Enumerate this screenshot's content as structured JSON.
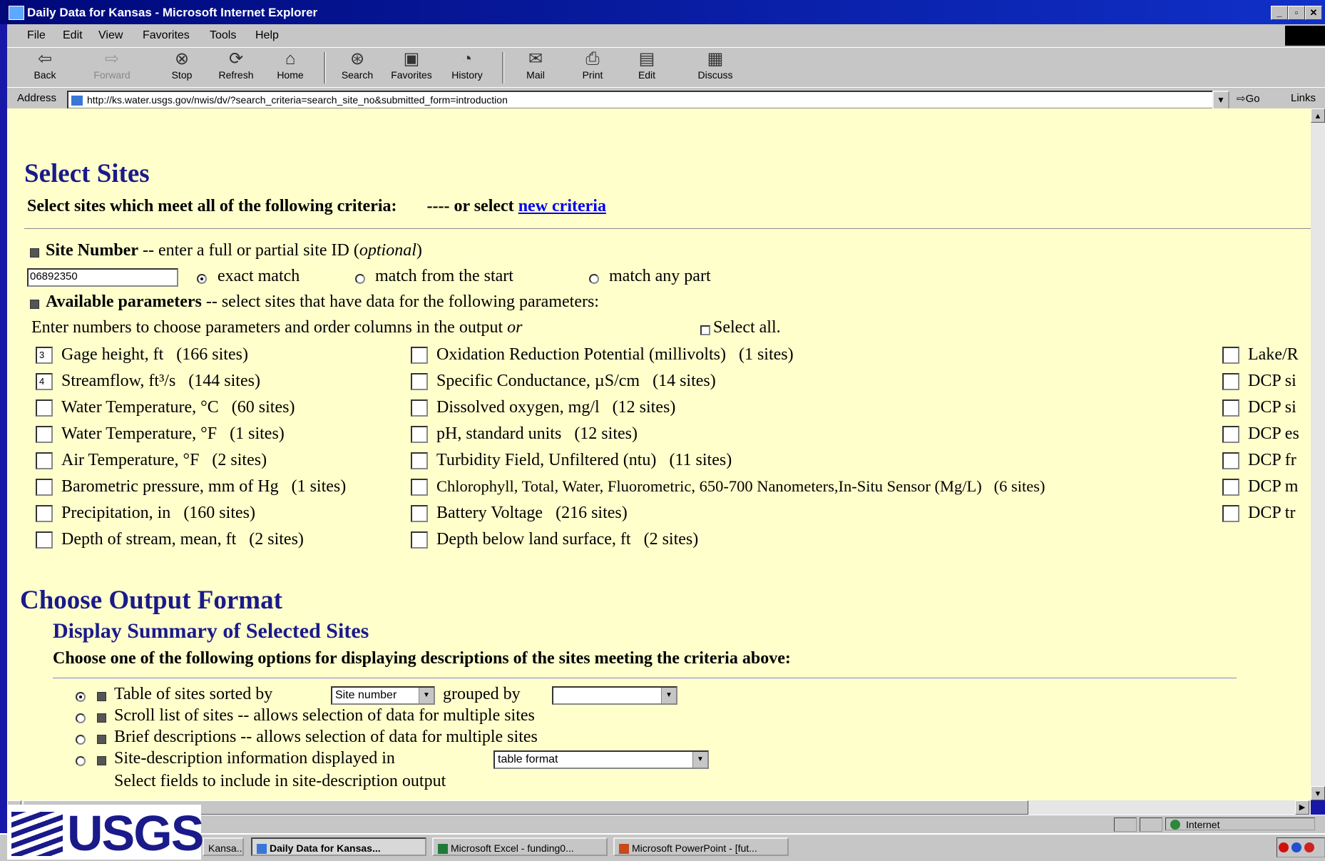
{
  "window": {
    "title": "Daily Data for Kansas - Microsoft Internet Explorer"
  },
  "menu": [
    "File",
    "Edit",
    "View",
    "Favorites",
    "Tools",
    "Help"
  ],
  "toolbar": {
    "back": "Back",
    "forward": "Forward",
    "stop": "Stop",
    "refresh": "Refresh",
    "home": "Home",
    "search": "Search",
    "favorites": "Favorites",
    "history": "History",
    "mail": "Mail",
    "print": "Print",
    "edit": "Edit",
    "discuss": "Discuss"
  },
  "address": {
    "label": "Address",
    "url": "http://ks.water.usgs.gov/nwis/dv/?search_criteria=search_site_no&submitted_form=introduction",
    "go": "Go",
    "links": "Links"
  },
  "page": {
    "select_sites": {
      "heading": "Select Sites",
      "criteria_line": "Select sites which meet all of the following criteria:",
      "or_select": "---- or select",
      "new_criteria_link": "new criteria"
    },
    "site_number": {
      "label": "Site Number",
      "desc": "-- enter a full or partial site ID (",
      "optional": "optional",
      "close": ")",
      "value": "06892350",
      "match_options": [
        "exact match",
        "match from the start",
        "match any part"
      ],
      "selected": 0
    },
    "parameters": {
      "label": "Available parameters",
      "desc": "-- select sites that have data for the following parameters:",
      "instruction": "Enter numbers to choose parameters and order columns in the output",
      "or": "or",
      "select_all": "Select all.",
      "col1": [
        {
          "order": "3",
          "name": "Gage height, ft",
          "count": "(166 sites)"
        },
        {
          "order": "4",
          "name": "Streamflow, ft³/s",
          "count": "(144 sites)"
        },
        {
          "order": "",
          "name": "Water Temperature, °C",
          "count": "(60 sites)"
        },
        {
          "order": "",
          "name": "Water Temperature, °F",
          "count": "(1 sites)"
        },
        {
          "order": "",
          "name": "Air Temperature, °F",
          "count": "(2 sites)"
        },
        {
          "order": "",
          "name": "Barometric pressure, mm of Hg",
          "count": "(1 sites)"
        },
        {
          "order": "",
          "name": "Precipitation, in",
          "count": "(160 sites)"
        },
        {
          "order": "",
          "name": "Depth of stream, mean, ft",
          "count": "(2 sites)"
        }
      ],
      "col2": [
        {
          "name": "Oxidation Reduction Potential (millivolts)",
          "count": "(1 sites)"
        },
        {
          "name": "Specific Conductance, µS/cm",
          "count": "(14 sites)"
        },
        {
          "name": "Dissolved oxygen, mg/l",
          "count": "(12 sites)"
        },
        {
          "name": "pH, standard units",
          "count": "(12 sites)"
        },
        {
          "name": "Turbidity Field, Unfiltered (ntu)",
          "count": "(11 sites)"
        },
        {
          "name": "Chlorophyll, Total, Water, Fluorometric, 650-700 Nanometers,In-Situ Sensor (Mg/L)",
          "count": "(6 sites)"
        },
        {
          "name": "Battery Voltage",
          "count": "(216 sites)"
        },
        {
          "name": "Depth below land surface, ft",
          "count": "(2 sites)"
        }
      ],
      "col3": [
        "Lake/R",
        "DCP si",
        "DCP si",
        "DCP es",
        "DCP fr",
        "DCP m",
        "DCP tr"
      ]
    },
    "output": {
      "heading": "Choose Output Format",
      "subheading": "Display Summary of Selected Sites",
      "instruction": "Choose one of the following options for displaying descriptions of the sites meeting the criteria above:",
      "opt_table": "Table of sites sorted by",
      "sorted_value": "Site number",
      "grouped_by": "grouped by",
      "grouped_value": "",
      "opt_scroll": "Scroll list of sites -- allows selection of data for multiple sites",
      "opt_brief": "Brief descriptions -- allows selection of data for multiple sites",
      "opt_sitedesc": "Site-description information displayed in",
      "sitedesc_value": "table format",
      "fields_line": "Select fields to include in site-description output"
    }
  },
  "status": {
    "zone": "Internet"
  },
  "taskbar": {
    "tasks": [
      "Kansa...",
      "Daily Data for Kansas...",
      "Microsoft Excel - funding0...",
      "Microsoft PowerPoint - [fut..."
    ]
  },
  "logo": {
    "text": "USGS"
  },
  "colors": {
    "heading": "#1a1a8a",
    "page_bg": "#ffffcc",
    "link": "#0000ee",
    "slide_bg": "#1818a8"
  }
}
